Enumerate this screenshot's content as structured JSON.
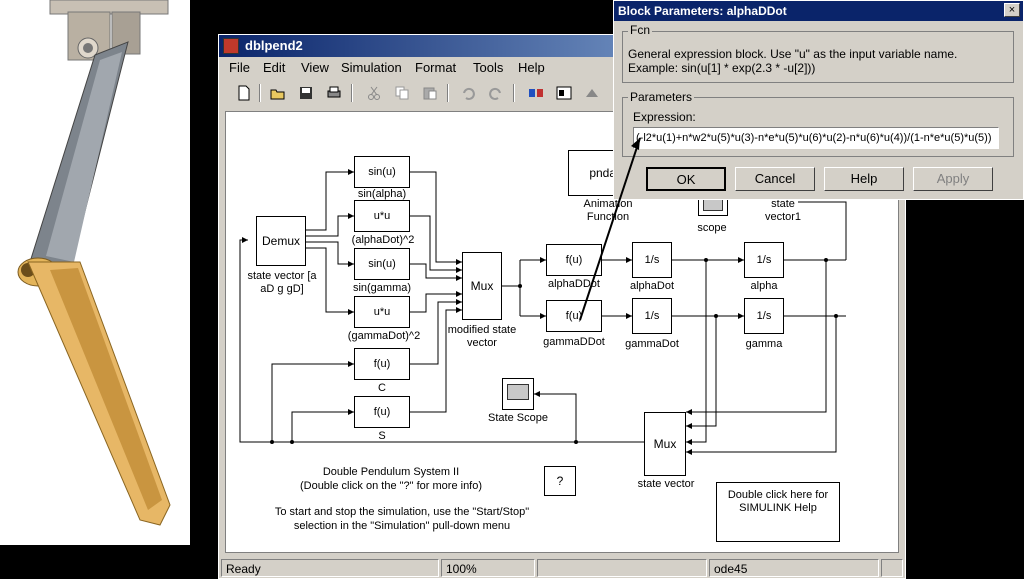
{
  "window": {
    "title": "dblpend2",
    "menus": [
      "File",
      "Edit",
      "View",
      "Simulation",
      "Format",
      "Tools",
      "Help"
    ]
  },
  "toolbar": {
    "icons": [
      "new-icon",
      "open-icon",
      "save-icon",
      "print-icon",
      "cut-icon",
      "copy-icon",
      "paste-icon",
      "undo-icon",
      "redo-icon",
      "library-browser-icon",
      "model-browser-icon",
      "build-icon",
      "debug-icon"
    ]
  },
  "diagram": {
    "demux": {
      "label": "Demux",
      "caption": "state vector [a aD g gD]"
    },
    "fcn_blocks": [
      {
        "text": "sin(u)",
        "caption": "sin(alpha)"
      },
      {
        "text": "u*u",
        "caption": "(alphaDot)^2"
      },
      {
        "text": "sin(u)",
        "caption": "sin(gamma)"
      },
      {
        "text": "u*u",
        "caption": "(gammaDot)^2"
      },
      {
        "text": "f(u)",
        "caption": "C"
      },
      {
        "text": "f(u)",
        "caption": "S"
      }
    ],
    "mux1": {
      "label": "Mux",
      "caption": "modified state vector"
    },
    "alphaddot": {
      "text": "f(u)",
      "caption": "alphaDDot"
    },
    "gammaddot": {
      "text": "f(u)",
      "caption": "gammaDDot"
    },
    "int_alphadot": {
      "text": "1/s",
      "caption": "alphaDot"
    },
    "int_alpha": {
      "text": "1/s",
      "caption": "alpha"
    },
    "int_gammadot": {
      "text": "1/s",
      "caption": "gammaDot"
    },
    "int_gamma": {
      "text": "1/s",
      "caption": "gamma"
    },
    "anim": {
      "text": "pndan",
      "caption": "Animation Function"
    },
    "scope_top": {
      "caption": "scope"
    },
    "state_vector1": {
      "caption": "state vector1"
    },
    "state_scope": {
      "caption": "State Scope"
    },
    "mux2": {
      "label": "Mux",
      "caption": "state vector"
    },
    "help_q": {
      "text": "?"
    },
    "help_box": {
      "text": "Double click here for SIMULINK Help"
    },
    "notes": {
      "title": "Double Pendulum System II",
      "sub": "(Double click on the \"?\" for more info)",
      "start1": "To start and stop the simulation, use the \"Start/Stop\"",
      "start2": "selection in the \"Simulation\" pull-down menu"
    }
  },
  "status": {
    "ready": "Ready",
    "zoom": "100%",
    "solver": "ode45"
  },
  "dialog": {
    "title": "Block Parameters: alphaDDot",
    "close": "×",
    "fcn_group": "Fcn",
    "fcn_desc1": "General expression block. Use \"u\" as the input variable name.",
    "fcn_desc2": "Example: sin(u[1] * exp(2.3 * -u[2]))",
    "params_group": "Parameters",
    "expr_label": "Expression:",
    "expr_value": "(-l2*u(1)+n*w2*u(5)*u(3)-n*e*u(5)*u(6)*u(2)-n*u(6)*u(4))/(1-n*e*u(5)*u(5))",
    "ok": "OK",
    "cancel": "Cancel",
    "help": "Help",
    "apply": "Apply"
  },
  "colors": {
    "title_active": "#0a246a",
    "face": "#d4d0c8",
    "pendulum_upper": "#8a8f96",
    "pendulum_lower": "#e8b860"
  }
}
